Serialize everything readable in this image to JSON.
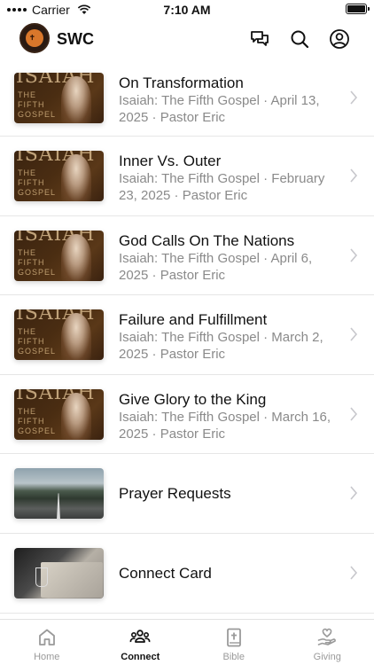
{
  "status_bar": {
    "carrier": "Carrier",
    "time": "7:10 AM",
    "battery_level": 1.0
  },
  "header": {
    "app_name": "SWC",
    "logo_mark": "SWC"
  },
  "sermon_thumb": {
    "title_word": "ISAIAH",
    "subtitle_line1": "THE",
    "subtitle_line2": "FIFTH",
    "subtitle_line3": "GOSPEL"
  },
  "items": [
    {
      "title": "On Transformation",
      "meta_line1": "Isaiah: The Fifth Gospel · April 13,",
      "meta_line2": "2025 · Pastor Eric",
      "thumb": "sermon"
    },
    {
      "title": "Inner Vs. Outer",
      "meta_line1": "Isaiah: The Fifth Gospel · February",
      "meta_line2": "23, 2025 · Pastor Eric",
      "thumb": "sermon"
    },
    {
      "title": "God Calls On The Nations",
      "meta_line1": "Isaiah: The Fifth Gospel · April 6,",
      "meta_line2": "2025 · Pastor Eric",
      "thumb": "sermon"
    },
    {
      "title": "Failure and Fulfillment",
      "meta_line1": "Isaiah: The Fifth Gospel · March 2,",
      "meta_line2": "2025 · Pastor Eric",
      "thumb": "sermon"
    },
    {
      "title": "Give Glory to the King",
      "meta_line1": "Isaiah: The Fifth Gospel · March 16,",
      "meta_line2": "2025 · Pastor Eric",
      "thumb": "sermon"
    },
    {
      "title": "Prayer Requests",
      "thumb": "road"
    },
    {
      "title": "Connect Card",
      "thumb": "connect"
    }
  ],
  "tabs": [
    {
      "label": "Home",
      "icon": "home-icon"
    },
    {
      "label": "Connect",
      "icon": "people-icon",
      "active": true
    },
    {
      "label": "Bible",
      "icon": "bible-icon"
    },
    {
      "label": "Giving",
      "icon": "giving-icon"
    }
  ],
  "colors": {
    "text": "#111111",
    "muted": "#8a8a8a",
    "tab_inactive": "#9a9a9a",
    "divider": "#e6e6e6"
  }
}
